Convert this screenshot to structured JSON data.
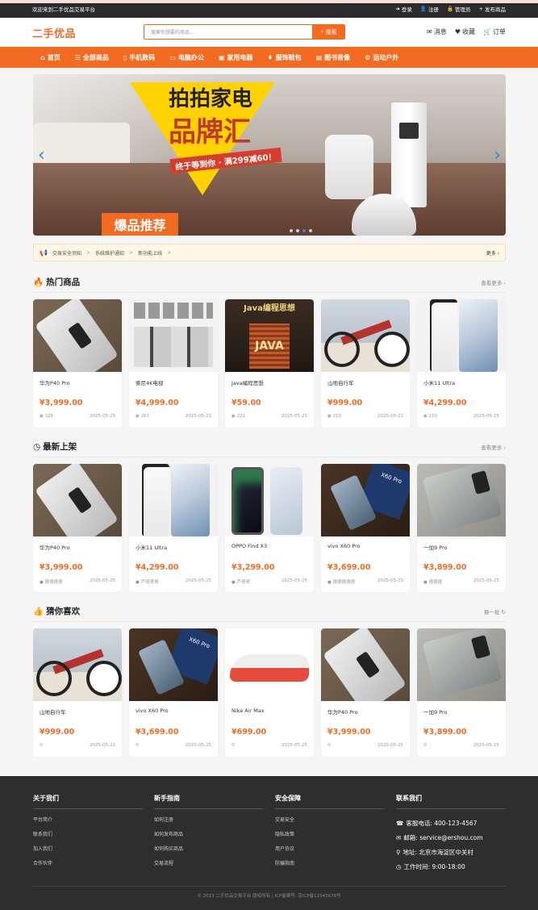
{
  "topbar": {
    "welcome": "欢迎来到二手优品交易平台",
    "links": [
      {
        "icon": "login-icon",
        "label": "登录"
      },
      {
        "icon": "user-plus-icon",
        "label": "注册"
      },
      {
        "icon": "lock-icon",
        "label": "管理员"
      },
      {
        "icon": "plus-icon",
        "label": "发布商品"
      }
    ]
  },
  "header": {
    "logo": "二手优品",
    "search": {
      "placeholder": "搜索你想要的商品...",
      "button_label": "搜索"
    },
    "links": [
      {
        "icon": "envelope-icon",
        "label": "消息"
      },
      {
        "icon": "heart-icon",
        "label": "收藏"
      },
      {
        "icon": "cart-icon",
        "label": "订单"
      }
    ]
  },
  "nav": {
    "items": [
      {
        "icon": "home-icon",
        "label": "首页"
      },
      {
        "icon": "list-icon",
        "label": "全部商品"
      },
      {
        "icon": "mobile-icon",
        "label": "手机数码"
      },
      {
        "icon": "laptop-icon",
        "label": "电脑办公"
      },
      {
        "icon": "tv-icon",
        "label": "家用电器"
      },
      {
        "icon": "shirt-icon",
        "label": "服饰鞋包"
      },
      {
        "icon": "book-icon",
        "label": "图书音像"
      },
      {
        "icon": "bicycle-icon",
        "label": "运动户外"
      }
    ]
  },
  "banner": {
    "line1": "拍拍家电",
    "line2": "品牌汇",
    "promo": "终于等到你 · 满299减60！",
    "badge": "爆品推荐",
    "prev": "‹",
    "next": "›",
    "active_slide": 3,
    "slide_count": 4
  },
  "notice": {
    "items": [
      "交易安全须知",
      "系统维护通知",
      "新功能上线"
    ],
    "more": "更多 ›"
  },
  "sections": {
    "hot": {
      "title": "热门商品",
      "more": "查看更多 ›",
      "products": [
        {
          "name": "华为P40 Pro",
          "price": "¥3,999.00",
          "meta_left": "325",
          "meta_right": "2025-05-25",
          "art": "img-phone-p40"
        },
        {
          "name": "索尼4K电视",
          "price": "¥4,999.00",
          "meta_left": "267",
          "meta_right": "2025-05-21",
          "art": "img-tv"
        },
        {
          "name": "Java编程思想",
          "price": "¥59.00",
          "meta_left": "222",
          "meta_right": "2025-05-21",
          "art": "img-book"
        },
        {
          "name": "山地自行车",
          "price": "¥999.00",
          "meta_left": "210",
          "meta_right": "2025-05-21",
          "art": "img-bike"
        },
        {
          "name": "小米11 Ultra",
          "price": "¥4,299.00",
          "meta_left": "210",
          "meta_right": "2025-05-25",
          "art": "img-mi11"
        }
      ]
    },
    "new": {
      "title": "最新上架",
      "more": "查看更多 ›",
      "products": [
        {
          "name": "华为P40 Pro",
          "price": "¥3,999.00",
          "meta_left": "德德德德",
          "meta_right": "2025-05-25",
          "art": "img-phone-p40"
        },
        {
          "name": "小米11 Ultra",
          "price": "¥4,299.00",
          "meta_left": "芦哥哥哥",
          "meta_right": "2025-05-25",
          "art": "img-mi11"
        },
        {
          "name": "OPPO Find X3",
          "price": "¥3,299.00",
          "meta_left": "芦哥哥",
          "meta_right": "2025-05-25",
          "art": "img-oppo"
        },
        {
          "name": "vivo X60 Pro",
          "price": "¥3,699.00",
          "meta_left": "德德德德德",
          "meta_right": "2025-05-25",
          "art": "img-vivo"
        },
        {
          "name": "一加9 Pro",
          "price": "¥3,899.00",
          "meta_left": "德德德",
          "meta_right": "2025-05-25",
          "art": "img-oneplus"
        }
      ]
    },
    "guess": {
      "title": "猜你喜欢",
      "more": "换一批",
      "products": [
        {
          "name": "山地自行车",
          "price": "¥999.00",
          "meta_left": "",
          "meta_right": "2025-05-21",
          "art": "img-bike"
        },
        {
          "name": "vivo X60 Pro",
          "price": "¥3,699.00",
          "meta_left": "",
          "meta_right": "2025-05-25",
          "art": "img-vivo"
        },
        {
          "name": "Nike Air Max",
          "price": "¥699.00",
          "meta_left": "",
          "meta_right": "2025-05-25",
          "art": "img-shoe"
        },
        {
          "name": "华为P40 Pro",
          "price": "¥3,999.00",
          "meta_left": "",
          "meta_right": "2025-05-25",
          "art": "img-phone-p40"
        },
        {
          "name": "一加9 Pro",
          "price": "¥3,899.00",
          "meta_left": "",
          "meta_right": "2025-05-25",
          "art": "img-oneplus"
        }
      ]
    }
  },
  "footer": {
    "columns": [
      {
        "title": "关于我们",
        "items": [
          "平台简介",
          "联系我们",
          "加入我们",
          "合作伙伴"
        ]
      },
      {
        "title": "新手指南",
        "items": [
          "如何注册",
          "如何发布商品",
          "如何购买商品",
          "交易流程"
        ]
      },
      {
        "title": "安全保障",
        "items": [
          "交易安全",
          "隐私政策",
          "用户协议",
          "防骗指南"
        ]
      }
    ],
    "contact": {
      "title": "联系我们",
      "items": [
        {
          "icon": "phone-icon",
          "label": "客服电话: 400-123-4567"
        },
        {
          "icon": "mail-icon",
          "label": "邮箱: service@ershou.com"
        },
        {
          "icon": "location-icon",
          "label": "地址: 北京市海淀区中关村"
        },
        {
          "icon": "clock-icon",
          "label": "工作时间: 9:00-18:00"
        }
      ]
    },
    "copyright": "© 2023 二手优品交易平台 版权所有 | ICP备案号: 京ICP备12345678号"
  },
  "colors": {
    "accent": "#f26b21",
    "topbar": "#2b2b2b",
    "footer": "#2e2e2e"
  }
}
